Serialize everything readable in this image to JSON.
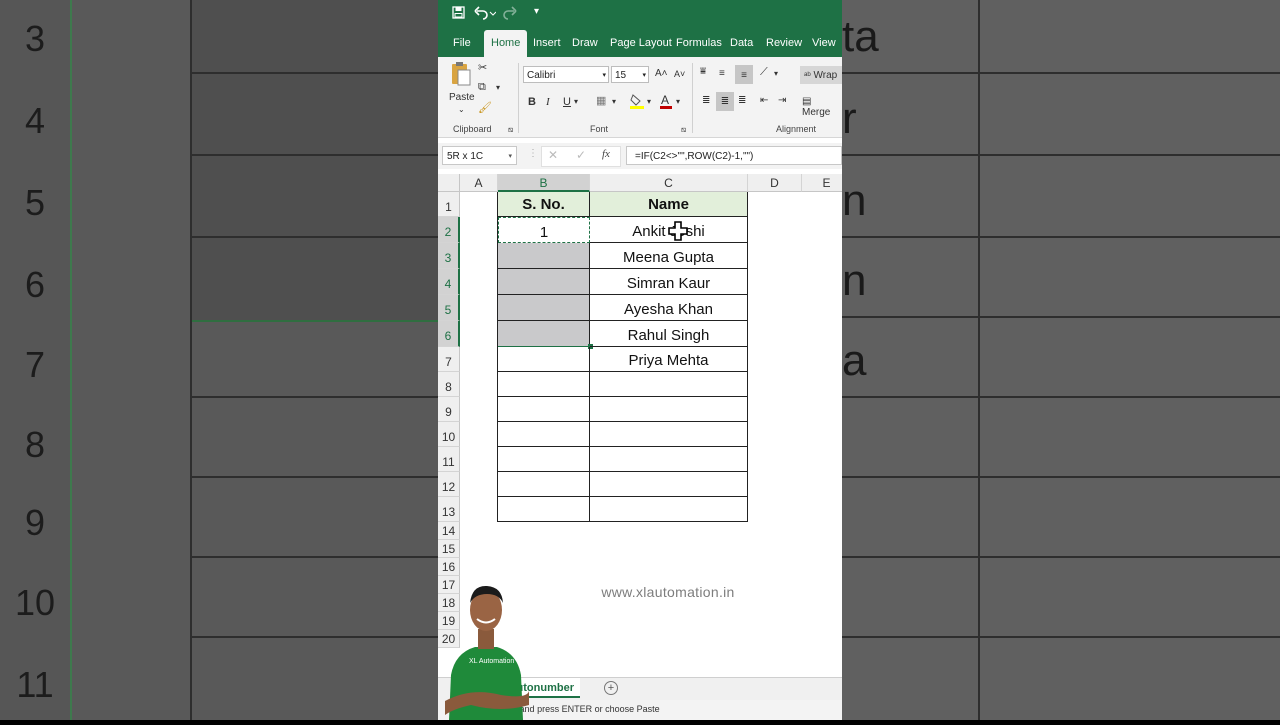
{
  "quick_access": {
    "save_icon": "save-icon",
    "undo_icon": "undo-icon",
    "redo_icon": "redo-icon",
    "customize_icon": "customize-qat-icon"
  },
  "ribbon_tabs": [
    "File",
    "Home",
    "Insert",
    "Draw",
    "Page Layout",
    "Formulas",
    "Data",
    "Review",
    "View"
  ],
  "active_tab": "Home",
  "ribbon": {
    "paste_label": "Paste",
    "clipboard_label": "Clipboard",
    "font_label": "Font",
    "alignment_label": "Alignment",
    "font_name": "Calibri",
    "font_size": "15",
    "wrap_label": "Wrap",
    "merge_label": "Merge",
    "bold": "B",
    "italic": "I",
    "underline": "U"
  },
  "formula_bar": {
    "name_box": "5R x 1C",
    "fx": "fx",
    "formula": "=IF(C2<>\"\",ROW(C2)-1,\"\")"
  },
  "columns": [
    "A",
    "B",
    "C",
    "D",
    "E"
  ],
  "rows": [
    "1",
    "2",
    "3",
    "4",
    "5",
    "6",
    "7",
    "8",
    "9",
    "10",
    "11",
    "12",
    "13",
    "14",
    "15",
    "16",
    "17",
    "18",
    "19",
    "20"
  ],
  "table": {
    "header_b": "S. No.",
    "header_c": "Name",
    "b2": "1",
    "names": [
      "Ankit Joshi",
      "Meena Gupta",
      "Simran Kaur",
      "Ayesha Khan",
      "Rahul Singh",
      "Priya Mehta"
    ]
  },
  "watermark": "www.xlautomation.in",
  "sheet_tab": "Autonumber",
  "status_text": "Select destination and press ENTER or choose Paste",
  "background_zoom": {
    "row_numbers": [
      "3",
      "4",
      "5",
      "6",
      "7",
      "8",
      "9",
      "10",
      "11"
    ],
    "text_fragments": [
      "ta",
      "r",
      "n",
      "n",
      "a"
    ]
  },
  "colors": {
    "excel_green": "#1e7145",
    "header_fill": "#e2efda",
    "selection_fill": "#c9c9cb"
  }
}
